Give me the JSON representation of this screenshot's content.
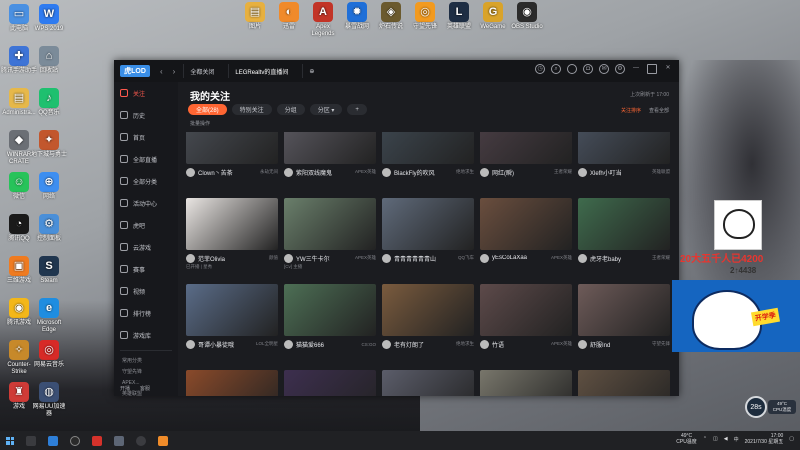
{
  "desktop": {
    "left_icons": [
      {
        "label": "此电脑",
        "color": "#4a90e2",
        "glyph": "▭"
      },
      {
        "label": "WPS 2019",
        "color": "#2f7bf0",
        "glyph": "W"
      },
      {
        "label": "腾讯手游助手",
        "color": "#3e74d6",
        "glyph": "✚"
      },
      {
        "label": "回收站",
        "color": "#7b8b99",
        "glyph": "⌂"
      },
      {
        "label": "Administra...",
        "color": "#e6b84a",
        "glyph": "▤"
      },
      {
        "label": "QQ音乐",
        "color": "#1ec06f",
        "glyph": "♪"
      },
      {
        "label": "WINRAR CRATE",
        "color": "#6b6f75",
        "glyph": "◆"
      },
      {
        "label": "地下城与勇士",
        "color": "#c2572d",
        "glyph": "✦"
      },
      {
        "label": "微信",
        "color": "#27c35a",
        "glyph": "☺"
      },
      {
        "label": "网络",
        "color": "#3d8ef0",
        "glyph": "⊕"
      },
      {
        "label": "腾讯QQ",
        "color": "#1a1a1a",
        "glyph": "◔"
      },
      {
        "label": "控制面板",
        "color": "#4a8fd8",
        "glyph": "⚙"
      },
      {
        "label": "三维游戏",
        "color": "#ef7b20",
        "glyph": "▣"
      },
      {
        "label": "Steam",
        "color": "#20364f",
        "glyph": "S"
      },
      {
        "label": "腾讯游戏",
        "color": "#f3b719",
        "glyph": "◉"
      },
      {
        "label": "Microsoft Edge",
        "color": "#1f8de0",
        "glyph": "e"
      },
      {
        "label": "Counter-Strike",
        "color": "#c7892a",
        "glyph": "✧"
      },
      {
        "label": "网易云音乐",
        "color": "#d72a27",
        "glyph": "◎"
      },
      {
        "label": "游戏",
        "color": "#cf3b37",
        "glyph": "♜"
      },
      {
        "label": "网易UU加速器",
        "color": "#3b4f74",
        "glyph": "◍"
      }
    ],
    "top_icons": [
      {
        "label": "图片",
        "color": "#e7b03f",
        "glyph": "▤"
      },
      {
        "label": "迅雷",
        "color": "#f08a2a",
        "glyph": "◐"
      },
      {
        "label": "Apex Legends",
        "color": "#c23427",
        "glyph": "A"
      },
      {
        "label": "暴雪战网",
        "color": "#1f6fd8",
        "glyph": "✹"
      },
      {
        "label": "炉石传说",
        "color": "#6b5a2e",
        "glyph": "◈"
      },
      {
        "label": "守望先锋",
        "color": "#f29a1f",
        "glyph": "◎"
      },
      {
        "label": "英雄联盟",
        "color": "#1e2e44",
        "glyph": "L"
      },
      {
        "label": "WeGame",
        "color": "#d9a32a",
        "glyph": "G"
      },
      {
        "label": "OBS Studio",
        "color": "#2b2b2b",
        "glyph": "◉"
      }
    ]
  },
  "app": {
    "logo": "虎LOD",
    "tabs": [
      {
        "label": "全都关闭"
      },
      {
        "label": "LEGRealtv&#8203;的直播间"
      },
      {
        "label": "⊕"
      }
    ],
    "sidebar": [
      {
        "label": "关注"
      },
      {
        "label": "历史"
      },
      {
        "label": "首页"
      },
      {
        "label": "全部直播"
      },
      {
        "label": "全部分类"
      },
      {
        "label": "活动中心"
      },
      {
        "label": "虎吧"
      },
      {
        "label": "云游戏"
      },
      {
        "label": "赛事"
      },
      {
        "label": "视频"
      },
      {
        "label": "排行榜"
      },
      {
        "label": "游戏库"
      }
    ],
    "sidebar_extra": [
      "常用分类",
      "守望先锋",
      "APEX...",
      "英雄联盟",
      "王者荣耀"
    ],
    "sidebar_bottom": [
      "开播",
      "客服"
    ],
    "page_title": "我的关注",
    "info_right": "上次刷新于 17:00",
    "filters": [
      {
        "label": "全部(28)",
        "active": true
      },
      {
        "label": "特别关注",
        "active": false
      },
      {
        "label": "分组",
        "active": false
      },
      {
        "label": "分区 ▾",
        "active": false
      },
      {
        "label": "+",
        "active": false
      }
    ],
    "action_hot": "关注排序",
    "action_more": "查看全部",
    "batch": "批量操作",
    "cards": [
      {
        "name": "Clown丶苦茶",
        "tag": "永劫无间",
        "sub": "",
        "hue": "#4a4e55"
      },
      {
        "name": "紫阳双线魔鬼",
        "tag": "APEX英雄",
        "sub": "",
        "hue": "#5d5b63"
      },
      {
        "name": "BlackFly的吹风",
        "tag": "绝地求生",
        "sub": "",
        "hue": "#3f4952"
      },
      {
        "name": "网红(瞬)",
        "tag": "王者荣耀",
        "sub": "",
        "hue": "#4b3f46"
      },
      {
        "name": "Xlefh小叮当",
        "tag": "英雄联盟",
        "sub": "",
        "hue": "#4a5361"
      },
      {
        "name": "范菲Olivia",
        "tag": "颜值",
        "sub": "已开播 | 星秀",
        "hue": "#e9e5e2"
      },
      {
        "name": "YW三牛卡尔",
        "tag": "APEX英雄",
        "sub": "[Cv] 主播",
        "hue": "#6a7f6b"
      },
      {
        "name": "青青青青青青山",
        "tag": "QQ飞车",
        "sub": "",
        "hue": "#5f6a7a"
      },
      {
        "name": "yEsCoLaXaa",
        "tag": "APEX英雄",
        "sub": "",
        "hue": "#6a4e3e"
      },
      {
        "name": "虎牙老baby",
        "tag": "王者荣耀",
        "sub": "",
        "hue": "#3f6b4d"
      },
      {
        "name": "哥谭小暴徒哦",
        "tag": "LOL全明星",
        "sub": "",
        "hue": "#5a6c88"
      },
      {
        "name": "猫猫爱666",
        "tag": "CS:GO",
        "sub": "",
        "hue": "#4d6f55"
      },
      {
        "name": "老有灯朗了",
        "tag": "绝地求生",
        "sub": "",
        "hue": "#7a5b3e"
      },
      {
        "name": "竹语",
        "tag": "APEX英雄",
        "sub": "",
        "hue": "#5d4a4a"
      },
      {
        "name": "舒服Ind",
        "tag": "守望先锋",
        "sub": "",
        "hue": "#6e5b59"
      },
      {
        "name": "",
        "tag": "",
        "sub": "",
        "hue": "#8a4a2a"
      },
      {
        "name": "",
        "tag": "",
        "sub": "",
        "hue": "#3d2f4f"
      },
      {
        "name": "",
        "tag": "",
        "sub": "",
        "hue": "#5b5d6a"
      },
      {
        "name": "",
        "tag": "",
        "sub": "",
        "hue": "#78766b"
      },
      {
        "name": "",
        "tag": "",
        "sub": "",
        "hue": "#5f5042"
      }
    ]
  },
  "promo": {
    "text": "20大五千人已4200",
    "sub": "2↑4438",
    "banner_badge": "开学季",
    "fab": "28s",
    "temp_line1": "49°C",
    "temp_line2": "CPU温度"
  },
  "taskbar": {
    "temp": "49°C",
    "temp_label": "CPU温度",
    "time": "17:00",
    "date": "2021/7/30 星期五"
  },
  "colors": {
    "accent": "#ff6633",
    "window_bg": "#1b1c20",
    "sidebar_active": "#ff5a4e"
  }
}
